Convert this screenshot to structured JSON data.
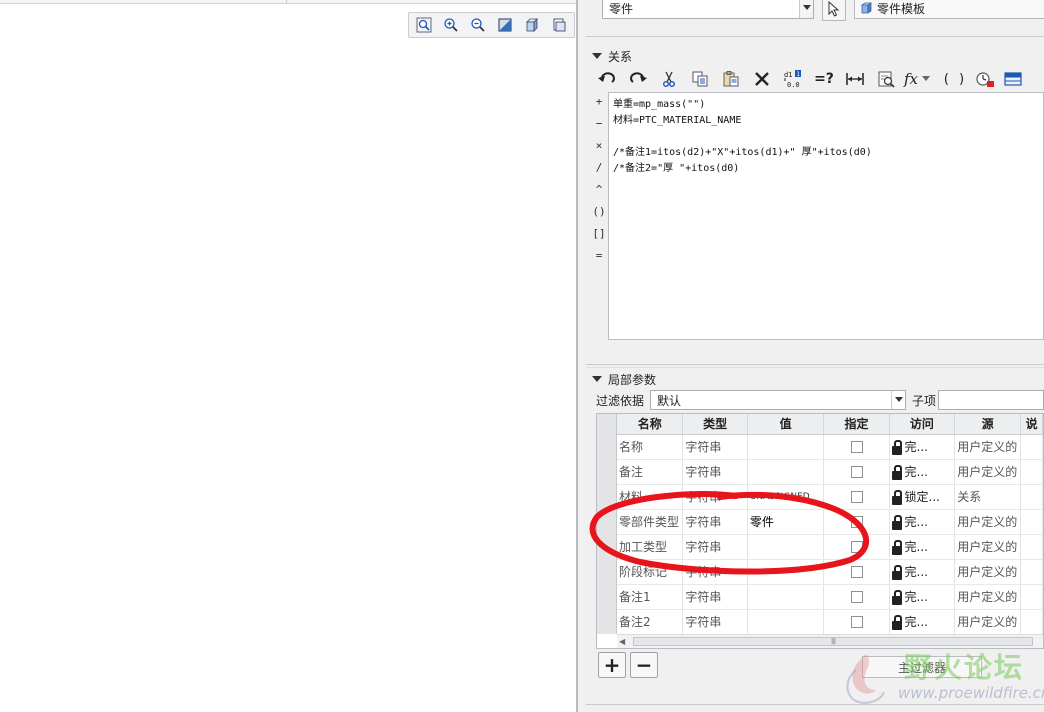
{
  "part_select": {
    "value": "零件"
  },
  "template_button": {
    "label": "零件模板"
  },
  "relations": {
    "title": "关系",
    "lines": [
      "单重=mp_mass(\"\")",
      "材料=PTC_MATERIAL_NAME",
      "",
      "/*备注1=itos(d2)+\"X\"+itos(d1)+\" 厚\"+itos(d0)",
      "/*备注2=\"厚 \"+itos(d0)"
    ],
    "operators": [
      "+",
      "−",
      "×",
      "/",
      "^",
      "()",
      "[]",
      "="
    ],
    "toolbar_icons": [
      "undo-icon",
      "redo-icon",
      "cut-icon",
      "copy-icon",
      "paste-icon",
      "delete-icon",
      "dimension-display-icon",
      "evaluate-icon",
      "insert-dimension-icon",
      "verify-icon",
      "function-icon",
      "brackets-icon",
      "sort-icon",
      "table-icon"
    ],
    "evaluate_label": "=?",
    "function_label": "fx",
    "brackets_label": "( )",
    "d1_label": "d1",
    "d1_sub": "0.0"
  },
  "local_params": {
    "title": "局部参数",
    "filter_label": "过滤依据",
    "filter_value": "默认",
    "sub_label": "子项",
    "columns": [
      "名称",
      "类型",
      "值",
      "指定",
      "访问",
      "源",
      "说"
    ],
    "rows": [
      {
        "name": "名称",
        "type": "字符串",
        "value": "",
        "access": "完...",
        "source": "用户定义的"
      },
      {
        "name": "备注",
        "type": "字符串",
        "value": "",
        "access": "完...",
        "source": "用户定义的"
      },
      {
        "name": "材料",
        "type": "字符串",
        "value": "UNASSIGNED",
        "access": "锁定...",
        "source": "关系"
      },
      {
        "name": "零部件类型",
        "type": "字符串",
        "value": "零件",
        "access": "完...",
        "source": "用户定义的"
      },
      {
        "name": "加工类型",
        "type": "字符串",
        "value": "",
        "access": "完...",
        "source": "用户定义的"
      },
      {
        "name": "阶段标记",
        "type": "字符串",
        "value": "",
        "access": "完...",
        "source": "用户定义的"
      },
      {
        "name": "备注1",
        "type": "字符串",
        "value": "",
        "access": "完...",
        "source": "用户定义的"
      },
      {
        "name": "备注2",
        "type": "字符串",
        "value": "",
        "access": "完...",
        "source": "用户定义的"
      }
    ],
    "scroll_grip": "||||",
    "add_label": "+",
    "remove_label": "−",
    "main_filter_label": "主过滤器"
  },
  "view_toolbar": [
    "zoom-fit-icon",
    "zoom-in-icon",
    "zoom-out-icon",
    "repaint-icon",
    "display-style-icon",
    "saved-views-icon"
  ],
  "watermark": {
    "title": "野火论坛",
    "url": "www.proewildfire.cn"
  },
  "colors": {
    "annotation": "#e8141b",
    "accent": "#1b58b8"
  }
}
